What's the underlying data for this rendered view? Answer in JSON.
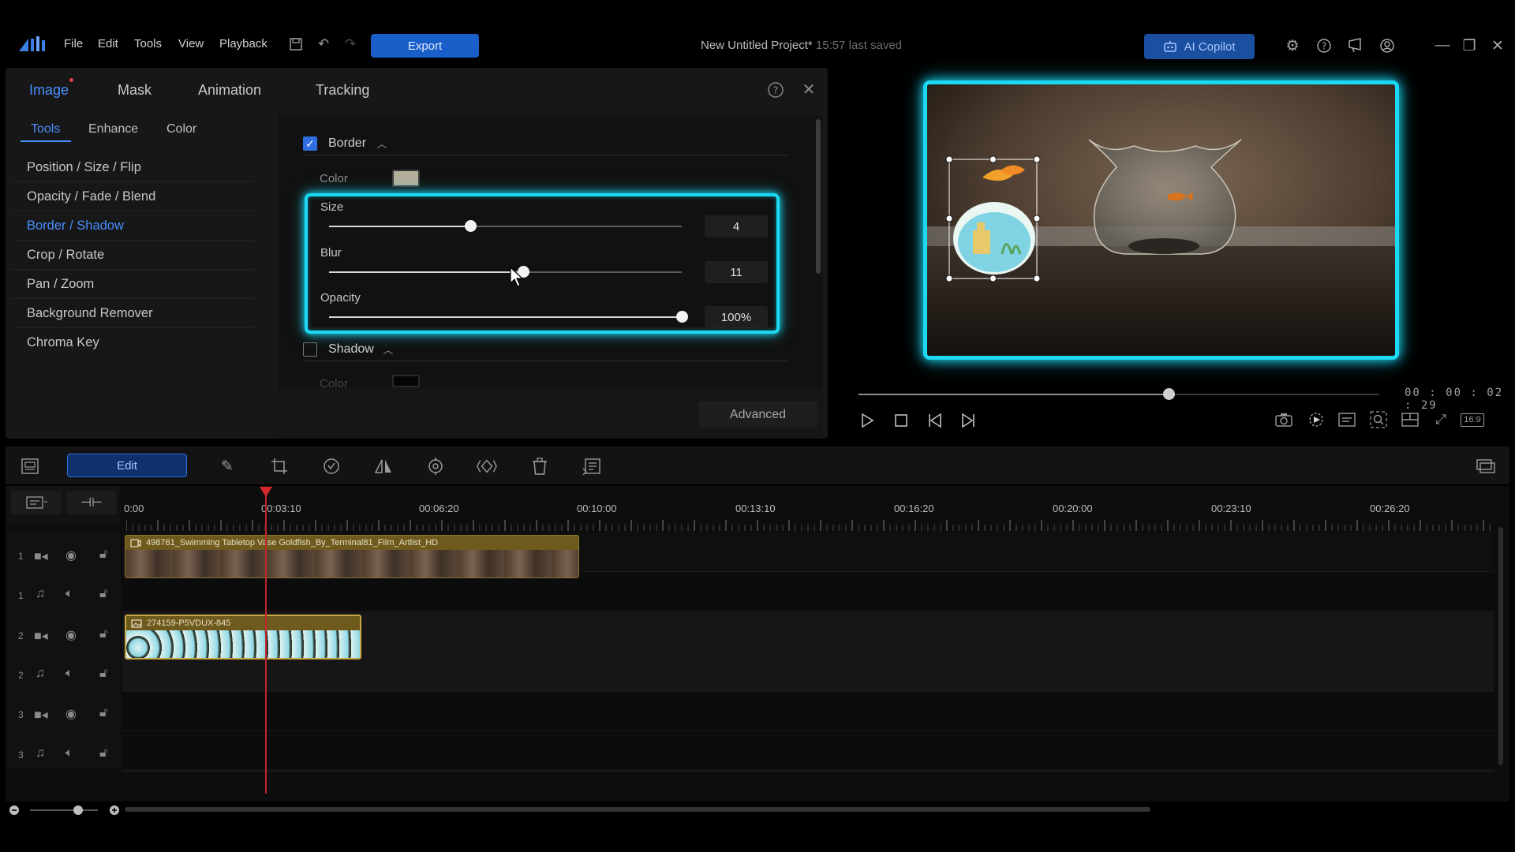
{
  "app": {
    "menu": [
      "File",
      "Edit",
      "Tools",
      "View",
      "Playback"
    ],
    "export_label": "Export",
    "project_title": "New Untitled Project*",
    "last_saved": "15:57 last saved",
    "copilot_label": "AI Copilot"
  },
  "panel": {
    "main_tabs": [
      "Image",
      "Mask",
      "Animation",
      "Tracking"
    ],
    "active_main_tab": "Image",
    "sub_tabs": [
      "Tools",
      "Enhance",
      "Color"
    ],
    "active_sub_tab": "Tools",
    "tools": [
      "Position / Size / Flip",
      "Opacity / Fade / Blend",
      "Border / Shadow",
      "Crop / Rotate",
      "Pan / Zoom",
      "Background Remover",
      "Chroma Key"
    ],
    "active_tool": "Border / Shadow",
    "border": {
      "title": "Border",
      "enabled": true,
      "color_label": "Color",
      "color_value": "#b4b09a",
      "size_label": "Size",
      "size_value": "4",
      "size_fraction": 0.4,
      "blur_label": "Blur",
      "blur_value": "11",
      "blur_fraction": 0.55,
      "opacity_label": "Opacity",
      "opacity_value": "100%",
      "opacity_fraction": 1.0
    },
    "shadow": {
      "title": "Shadow",
      "enabled": false,
      "color_label": "Color"
    },
    "advanced_label": "Advanced"
  },
  "preview": {
    "timecode": "00 : 00 : 02 : 29",
    "aspect_ratio": "16:9",
    "progress_fraction": 0.6
  },
  "toolbar": {
    "edit_label": "Edit"
  },
  "timeline": {
    "ruler_labels": [
      "0:00",
      "00:03:10",
      "00:06:20",
      "00:10:00",
      "00:13:10",
      "00:16:20",
      "00:20:00",
      "00:23:10",
      "00:26:20"
    ],
    "tracks": [
      {
        "num": "1",
        "kind": "video"
      },
      {
        "num": "1",
        "kind": "audio"
      },
      {
        "num": "2",
        "kind": "video"
      },
      {
        "num": "2",
        "kind": "audio"
      },
      {
        "num": "3",
        "kind": "video"
      },
      {
        "num": "3",
        "kind": "audio"
      }
    ],
    "clips": [
      {
        "track": 0,
        "name": "498761_Swimming Tabletop Vase Goldfish_By_Terminal81_Film_Artlist_HD"
      },
      {
        "track": 2,
        "name": "274159-P5VDUX-845"
      }
    ]
  },
  "colors": {
    "accent": "#2f6fe0",
    "highlight": "#1bd9f5",
    "playhead": "#c0262b",
    "clip_video": "#6e5a1c"
  }
}
